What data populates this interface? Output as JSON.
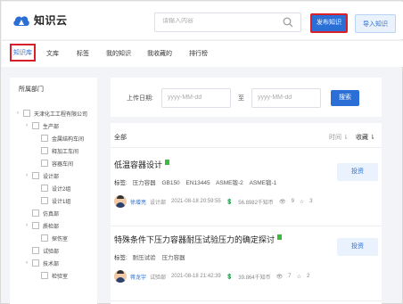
{
  "header": {
    "logo_text": "知识云",
    "search_placeholder": "请输入内容",
    "publish_label": "发布知识",
    "import_label": "导入知识"
  },
  "nav": {
    "items": [
      "知识库",
      "文库",
      "标签",
      "我的知识",
      "我收藏的",
      "排行榜"
    ],
    "active": "知识库"
  },
  "sidebar": {
    "title": "所属部门",
    "tree": [
      {
        "label": "天津化工工程有限公司",
        "expandable": true,
        "level": 0
      },
      {
        "label": "生产部",
        "expandable": true,
        "level": 1
      },
      {
        "label": "金属结构车间",
        "expandable": false,
        "level": 2
      },
      {
        "label": "释加工车间",
        "expandable": false,
        "level": 2
      },
      {
        "label": "容器车间",
        "expandable": false,
        "level": 2
      },
      {
        "label": "设计部",
        "expandable": true,
        "level": 1
      },
      {
        "label": "设计2组",
        "expandable": false,
        "level": 2
      },
      {
        "label": "设计1组",
        "expandable": false,
        "level": 2
      },
      {
        "label": "仿真部",
        "expandable": false,
        "level": 1
      },
      {
        "label": "质检部",
        "expandable": true,
        "level": 1
      },
      {
        "label": "探伤室",
        "expandable": false,
        "level": 2
      },
      {
        "label": "试验部",
        "expandable": false,
        "level": 1
      },
      {
        "label": "技术部",
        "expandable": true,
        "level": 1
      },
      {
        "label": "检验室",
        "expandable": false,
        "level": 2
      }
    ]
  },
  "filter": {
    "upload_date_label": "上传日期:",
    "start_placeholder": "yyyy-MM-dd",
    "to_label": "至",
    "end_placeholder": "yyyy-MM-dd",
    "search_button": "搜索"
  },
  "list": {
    "all_label": "全部",
    "sort_time": "时间 ⇂",
    "sort_favorite": "收藏 ⇂",
    "items": [
      {
        "title": "低温容器设计",
        "tags_label": "标签:",
        "tags": [
          "压力容器",
          "GB150",
          "EN13445",
          "ASME锻-2",
          "ASME锻-1"
        ],
        "author": "徐增亮",
        "department": "设计部",
        "datetime": "2021-08-18 20:59:55",
        "coins": "56.8982千知币",
        "views": "9",
        "favorites": "3",
        "download_label": "投资"
      },
      {
        "title": "特殊条件下压力容器耐压试验压力的确定探讨",
        "tags_label": "标签:",
        "tags": [
          "耐压试验",
          "压力容器"
        ],
        "author": "蒋龙宇",
        "department": "试验部",
        "datetime": "2021-08-18 21:42:39",
        "coins": "39.864千知币",
        "views": "7",
        "favorites": "2",
        "download_label": "投资"
      }
    ]
  },
  "colors": {
    "primary": "#2b6fd6",
    "highlight_border": "#d9202a"
  }
}
